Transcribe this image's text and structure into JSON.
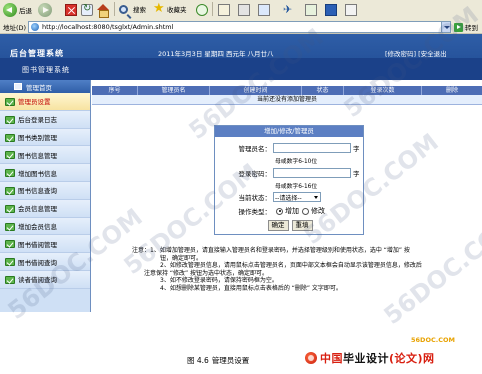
{
  "browser": {
    "back_label": "后退",
    "search_label": "搜索",
    "favorites_label": "收藏夹",
    "address_label": "地址(D)",
    "url": "http://localhost:8080/tsglxt/Admin.shtml",
    "go_label": "转到"
  },
  "header": {
    "logo": "后台管理系统",
    "subtitle": "图书管理系统",
    "datetime": "2011年3月3日 星期四 西元年  八月廿八",
    "links": "[修改密码] [安全退出"
  },
  "sidebar": {
    "heading": "管理首页",
    "items": [
      {
        "label": "管理员设置",
        "active": true
      },
      {
        "label": "后台登录日志",
        "active": false
      },
      {
        "label": "图书类别管理",
        "active": false
      },
      {
        "label": "图书信息管理",
        "active": false
      },
      {
        "label": "增加图书信息",
        "active": false
      },
      {
        "label": "图书信息查询",
        "active": false
      },
      {
        "label": "会员信息管理",
        "active": false
      },
      {
        "label": "增加会员信息",
        "active": false
      },
      {
        "label": "图书借阅管理",
        "active": false
      },
      {
        "label": "图书借阅查询",
        "active": false
      },
      {
        "label": "读者借阅查询",
        "active": false
      }
    ]
  },
  "table": {
    "columns": [
      "序号",
      "管理员名",
      "创建时间",
      "状态",
      "登录次数",
      "删除"
    ],
    "empty_message": "当前还没有添加管理员"
  },
  "form": {
    "title": "增加/修改/管理员",
    "name_label": "管理员名：",
    "name_value": "",
    "name_unit": "字",
    "name_hint": "母或数字6-10位",
    "password_label": "登录密码：",
    "password_value": "",
    "password_unit": "字",
    "password_hint": "母或数字6-16位",
    "status_label": "当前状态：",
    "status_value": "--请选择--",
    "operation_label": "操作类型：",
    "operation_add": "增加",
    "operation_edit": "修改",
    "operation_selected": "add",
    "confirm_label": "确定",
    "reset_label": "重填"
  },
  "notes": [
    "注意：1、如增加管理员，请直接输入管理员名和登录密码，并选择管理级别和使用状态，选中 “增加” 按",
    "钮，确定即可。",
    "2、如修改管理员信息，请用鼠标点击管理员名，页面中部文本框会自动显示该管理员信息，修改后",
    "注意保持 “修改” 按钮为选中状态，确定即可。",
    "3、如不修改登录密码，请保持密码框为空。",
    "4、如想删除某管理员，直接用鼠标点击表格后的 “删除” 文字即可。"
  ],
  "watermarks": [
    "56DOC.COM",
    "56DOC.COM",
    "56DOC.COM",
    "56DOC.COM",
    "56DOC.COM",
    "56DOC.COM"
  ],
  "footer": {
    "site": "56DOC.COM",
    "caption_num": "图 4.6",
    "caption_text": "管理员设置",
    "brand_red": "中国",
    "brand_black": "毕业设计",
    "brand_red2": "(论文)网"
  }
}
